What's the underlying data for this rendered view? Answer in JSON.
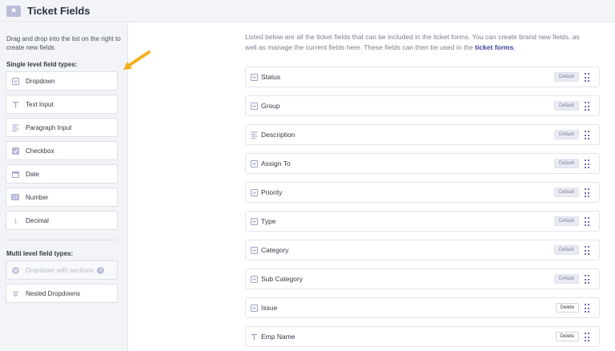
{
  "header": {
    "title": "Ticket Fields",
    "icon": "ticket-icon"
  },
  "sidebar": {
    "hint": "Drag and drop into the list on the right to create new fields",
    "single_title": "Single level field types:",
    "single_items": [
      {
        "label": "Dropdown",
        "icon": "dropdown-icon"
      },
      {
        "label": "Text Input",
        "icon": "text-icon"
      },
      {
        "label": "Paragraph Input",
        "icon": "paragraph-icon"
      },
      {
        "label": "Checkbox",
        "icon": "checkbox-icon"
      },
      {
        "label": "Date",
        "icon": "calendar-icon"
      },
      {
        "label": "Number",
        "icon": "number-icon"
      },
      {
        "label": "Decimal",
        "icon": "decimal-icon"
      }
    ],
    "multi_title": "Multi level field types:",
    "multi_items": [
      {
        "label": "Dropdown with sections",
        "icon": "dropdown-sections-icon",
        "disabled": true,
        "info": "i"
      },
      {
        "label": "Nested Dropdowns",
        "icon": "nested-icon"
      }
    ]
  },
  "main": {
    "intro_text": "Listed below are all the ticket fields that can be included in the ticket forms. You can create brand new fields, as well as manage the current fields here. These fields can then be used in the ",
    "intro_link": "ticket forms",
    "intro_end": ".",
    "fields": [
      {
        "label": "Status",
        "icon": "dropdown-icon",
        "action": "Default"
      },
      {
        "label": "Group",
        "icon": "dropdown-icon",
        "action": "Default"
      },
      {
        "label": "Description",
        "icon": "paragraph-icon",
        "action": "Default"
      },
      {
        "label": "Assign To",
        "icon": "dropdown-icon",
        "action": "Default"
      },
      {
        "label": "Priority",
        "icon": "dropdown-icon",
        "action": "Default"
      },
      {
        "label": "Type",
        "icon": "dropdown-icon",
        "action": "Default"
      },
      {
        "label": "Category",
        "icon": "dropdown-icon",
        "action": "Default"
      },
      {
        "label": "Sub Category",
        "icon": "dropdown-icon",
        "action": "Default"
      },
      {
        "label": "Issue",
        "icon": "dropdown-icon",
        "action": "Delete"
      },
      {
        "label": "Emp Name",
        "icon": "text-icon",
        "action": "Delete"
      }
    ]
  },
  "colors": {
    "accent": "#3a3f9e",
    "arrow": "#f2b01e",
    "icon": "#9ea3c2"
  }
}
